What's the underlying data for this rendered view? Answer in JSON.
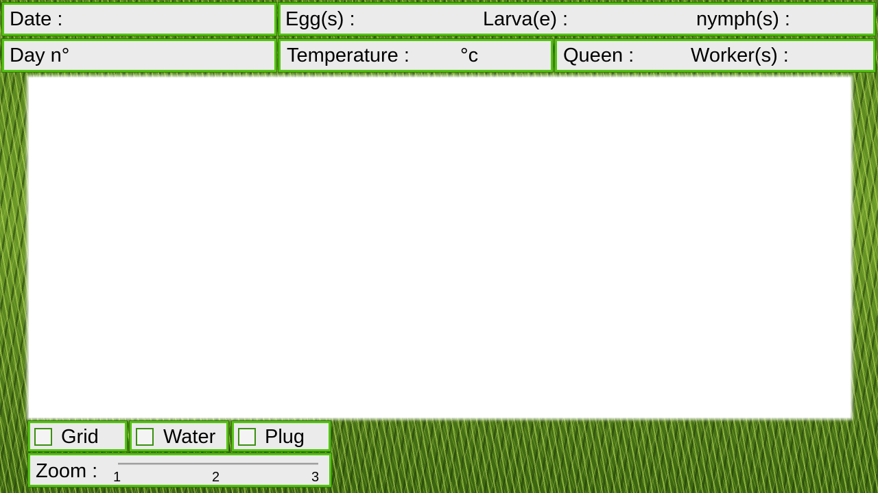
{
  "header": {
    "date_label": "Date :",
    "day_label": "Day n°",
    "eggs_label": "Egg(s) :",
    "larvae_label": "Larva(e) :",
    "nymphs_label": "nymph(s) :",
    "temperature_label": "Temperature :",
    "temperature_unit": "°c",
    "queen_label": "Queen :",
    "workers_label": "Worker(s) :"
  },
  "controls": {
    "grid_label": "Grid",
    "water_label": "Water",
    "plug_label": "Plug",
    "grid_checked": false,
    "water_checked": false,
    "plug_checked": false,
    "zoom_label": "Zoom :",
    "zoom_ticks": [
      "1",
      "2",
      "3"
    ]
  },
  "colors": {
    "panel_border": "#55c313",
    "panel_background": "#ebebeb",
    "canvas_background": "#ffffff"
  },
  "icons": {
    "background": "grass-texture"
  }
}
